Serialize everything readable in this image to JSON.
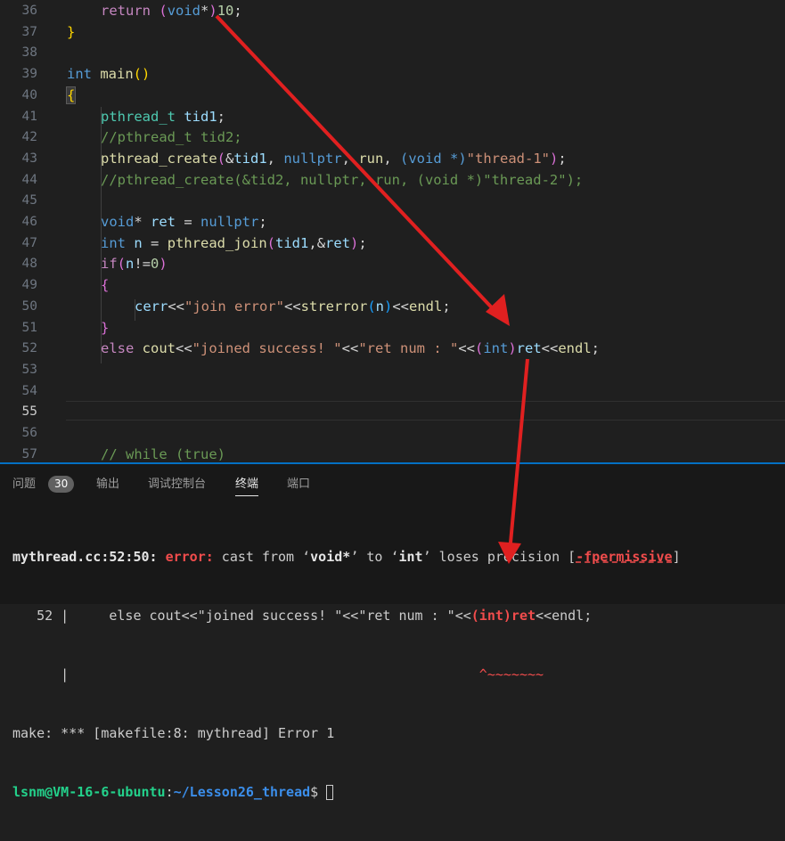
{
  "editor": {
    "lines": [
      {
        "n": "36"
      },
      {
        "n": "37"
      },
      {
        "n": "38"
      },
      {
        "n": "39"
      },
      {
        "n": "40"
      },
      {
        "n": "41"
      },
      {
        "n": "42"
      },
      {
        "n": "43"
      },
      {
        "n": "44"
      },
      {
        "n": "45"
      },
      {
        "n": "46"
      },
      {
        "n": "47"
      },
      {
        "n": "48"
      },
      {
        "n": "49"
      },
      {
        "n": "50"
      },
      {
        "n": "51"
      },
      {
        "n": "52"
      },
      {
        "n": "53"
      },
      {
        "n": "54"
      },
      {
        "n": "55"
      },
      {
        "n": "56"
      },
      {
        "n": "57"
      }
    ],
    "code": {
      "l36": {
        "kw": "return",
        "cast_open": "(",
        "void": "void",
        "star": "*",
        "cast_close": ")",
        "num": "10",
        "semi": ";"
      },
      "l37": {
        "brace": "}"
      },
      "l39": {
        "type": "int",
        "name": "main",
        "parens": "()"
      },
      "l40": {
        "brace": "{"
      },
      "l41": {
        "type": "pthread_t",
        "var": "tid1",
        "semi": ";"
      },
      "l42": {
        "comment": "//pthread_t tid2;"
      },
      "l43": {
        "fn": "pthread_create",
        "p1": "(",
        "amp": "&",
        "tid": "tid1",
        "c1": ", ",
        "nullptr": "nullptr",
        "c2": ", ",
        "run": "run",
        "c3": ", ",
        "cast": "(void *)",
        "str": "\"thread-1\"",
        "p2": ")",
        "semi": ";"
      },
      "l44": {
        "comment": "//pthread_create(&tid2, nullptr, run, (void *)\"thread-2\");"
      },
      "l46": {
        "void": "void",
        "star": "* ",
        "var": "ret",
        "eq": " = ",
        "nullptr": "nullptr",
        "semi": ";"
      },
      "l47": {
        "type": "int",
        "var": "n",
        "eq": " = ",
        "fn": "pthread_join",
        "p1": "(",
        "tid": "tid1",
        "c": ",",
        "amp": "&",
        "ret": "ret",
        "p2": ")",
        "semi": ";"
      },
      "l48": {
        "kw": "if",
        "p1": "(",
        "var": "n",
        "op": "!=",
        "num": "0",
        "p2": ")"
      },
      "l49": {
        "brace": "{"
      },
      "l50": {
        "var": "cerr",
        "op1": "<<",
        "str": "\"join error\"",
        "op2": "<<",
        "fn": "strerror",
        "p1": "(",
        "n": "n",
        "p2": ")",
        "op3": "<<",
        "endl": "endl",
        "semi": ";"
      },
      "l51": {
        "brace": "}"
      },
      "l52": {
        "kw": "else",
        "cout": "cout",
        "op1": "<<",
        "str1": "\"joined success! \"",
        "op2": "<<",
        "str2": "\"ret num : \"",
        "op3": "<<",
        "p1": "(",
        "type": "int",
        "p2": ")",
        "ret": "ret",
        "op4": "<<",
        "endl": "endl",
        "semi": ";"
      },
      "l57": {
        "comment": "// while (true)"
      }
    }
  },
  "panel": {
    "tabs": [
      "问题",
      "输出",
      "调试控制台",
      "终端",
      "端口"
    ],
    "problems_count": "30",
    "active_tab": "终端"
  },
  "terminal": {
    "err_loc": "mythread.cc:52:50:",
    "err_word": "error:",
    "err_msg1": " cast from ‘",
    "err_t1": "void*",
    "err_msg2": "’ to ‘",
    "err_t2": "int",
    "err_msg3": "’ loses precision [",
    "err_flag": "-fpermissive",
    "err_msg4": "]",
    "src_prefix": "   52 |     else cout<<\"joined success! \"<<\"ret num : \"<<",
    "src_hl": "(int)ret",
    "src_suffix": "<<endl;",
    "marker_prefix": "      |                                                   ",
    "marker": "^~~~~~~~",
    "make_line": "make: *** [makefile:8: mythread] Error 1",
    "prompt_user": "lsnm@VM-16-6-ubuntu",
    "prompt_sep": ":",
    "prompt_path": "~/Lesson26_thread",
    "prompt_end": "$ "
  },
  "colors": {
    "annotation_arrow": "#e02020"
  }
}
